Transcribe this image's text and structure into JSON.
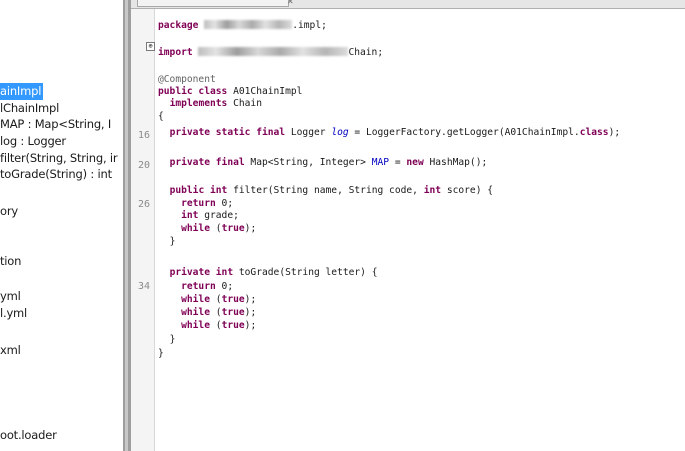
{
  "tree": {
    "items": [
      {
        "label": "ainImpl",
        "selected": true
      },
      {
        "label": "lChainImpl",
        "selected": false
      },
      {
        "label": "MAP : Map<String, I",
        "selected": false
      },
      {
        "label": "log : Logger",
        "selected": false
      },
      {
        "label": "filter(String, String, ir",
        "selected": false
      },
      {
        "label": "toGrade(String) : int",
        "selected": false
      },
      {
        "label": "ory",
        "selected": false
      },
      {
        "label": "tion",
        "selected": false
      },
      {
        "label": "yml",
        "selected": false
      },
      {
        "label": "l.yml",
        "selected": false
      },
      {
        "label": "xml",
        "selected": false
      },
      {
        "label": "oot.loader",
        "selected": false
      }
    ]
  },
  "gutter": {
    "line_numbers": [
      "16",
      "20",
      "26",
      "34"
    ],
    "fold_symbol": "⊕"
  },
  "code": {
    "package_kw": "package",
    "package_tail": ".impl;",
    "import_kw": "import",
    "import_tail": "Chain;",
    "annotation": "@Component",
    "l_class_1": "public class",
    "l_class_2": " A01ChainImpl",
    "l_impl_1": "implements",
    "l_impl_2": " Chain",
    "open_brace": "{",
    "l16_kw": "private static final",
    "l16_type": " Logger ",
    "l16_field": "log",
    "l16_rest": " = LoggerFactory.getLogger(A01ChainImpl.",
    "l16_class": "class",
    "l16_end": ");",
    "l20_kw": "private final",
    "l20_type": " Map<String, Integer> ",
    "l20_field": "MAP",
    "l20_mid": " = ",
    "l20_new": "new",
    "l20_end": " HashMap();",
    "filter_kw1": "public int",
    "filter_mid1": " filter(String name, String code, ",
    "filter_kw2": "int",
    "filter_end": " score) {",
    "return_kw": "return",
    "return_val": " 0;",
    "grade_kw": "int",
    "grade_end": " grade;",
    "while_kw": "while",
    "while_open": " (",
    "true_kw": "true",
    "while_close": ");",
    "close_brace": "}",
    "togr_kw": "private int",
    "togr_end": " toGrade(String letter) {"
  }
}
